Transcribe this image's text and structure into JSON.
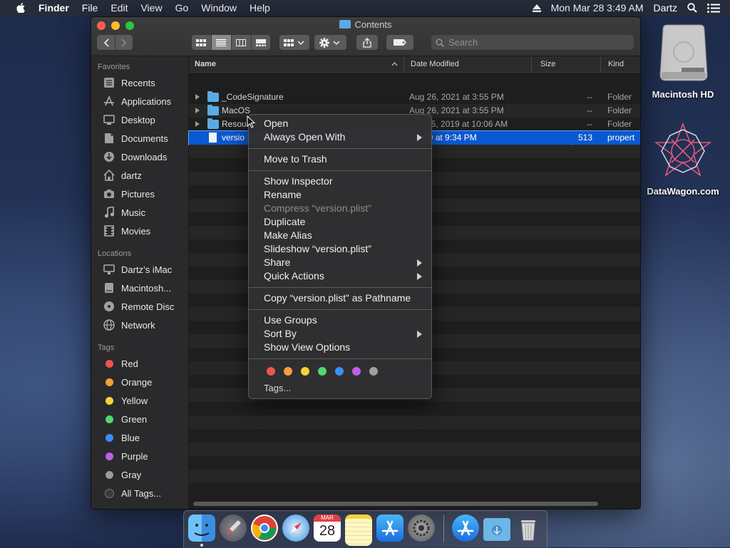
{
  "menubar": {
    "app": "Finder",
    "items": [
      "File",
      "Edit",
      "View",
      "Go",
      "Window",
      "Help"
    ],
    "clock": "Mon Mar 28  3:49 AM",
    "user": "Dartz"
  },
  "window": {
    "title": "Contents",
    "search_placeholder": "Search"
  },
  "sidebar": {
    "favorites_label": "Favorites",
    "favorites": [
      "Recents",
      "Applications",
      "Desktop",
      "Documents",
      "Downloads",
      "dartz",
      "Pictures",
      "Music",
      "Movies"
    ],
    "locations_label": "Locations",
    "locations": [
      "Dartz’s iMac",
      "Macintosh...",
      "Remote Disc",
      "Network"
    ],
    "tags_label": "Tags",
    "tags": [
      "Red",
      "Orange",
      "Yellow",
      "Green",
      "Blue",
      "Purple",
      "Gray",
      "All Tags..."
    ],
    "tag_colors": [
      "#f0544f",
      "#f5a03a",
      "#f5d33a",
      "#53d66b",
      "#3a8ff5",
      "#c15ee6",
      "#9a9a9a",
      "#3a3a3a"
    ]
  },
  "columns": {
    "name": "Name",
    "date": "Date Modified",
    "size": "Size",
    "kind": "Kind"
  },
  "files": [
    {
      "name": "_CodeSignature",
      "date": "Aug 26, 2021 at 3:55 PM",
      "size": "--",
      "kind": "Folder"
    },
    {
      "name": "MacOS",
      "date": "Aug 26, 2021 at 3:55 PM",
      "size": "--",
      "kind": "Folder"
    },
    {
      "name": "Resources",
      "date": "Feb 25, 2019 at 10:06 AM",
      "size": "--",
      "kind": "Folder"
    },
    {
      "name": "versio",
      "date": ", 2019 at 9:34 PM",
      "size": "513 bytes",
      "kind": "propert"
    }
  ],
  "context_menu": {
    "open": "Open",
    "always_open_with": "Always Open With",
    "move_to_trash": "Move to Trash",
    "show_inspector": "Show Inspector",
    "rename": "Rename",
    "compress": "Compress “version.plist”",
    "duplicate": "Duplicate",
    "make_alias": "Make Alias",
    "slideshow": "Slideshow “version.plist”",
    "share": "Share",
    "quick_actions": "Quick Actions",
    "copy_pathname": "Copy “version.plist” as Pathname",
    "use_groups": "Use Groups",
    "sort_by": "Sort By",
    "show_view_options": "Show View Options",
    "tags": "Tags...",
    "tag_colors": [
      "#f0544f",
      "#f5a03a",
      "#f5d33a",
      "#53d66b",
      "#3a8ff5",
      "#c15ee6",
      "#a0a0a0"
    ]
  },
  "desktop": {
    "hd_label": "Macintosh HD",
    "datawagon_label": "DataWagon.com"
  },
  "dock": {
    "calendar_month": "MAR",
    "calendar_day": "28"
  }
}
